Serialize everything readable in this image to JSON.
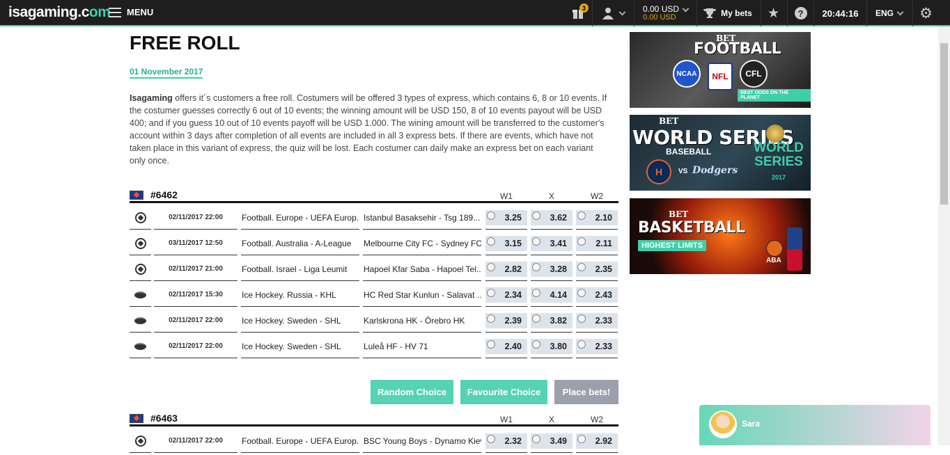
{
  "header": {
    "logo_main": "isagaming.c",
    "logo_accent": "om",
    "menu_label": "MENU",
    "gift_count": "3",
    "balance_main": "0.00 USD",
    "balance_bonus": "0.00 USD",
    "mybets_label": "My bets",
    "time": "20:44:16",
    "language": "ENG",
    "accent_color": "#3fcfa8",
    "icons": [
      "menu-icon",
      "gift-icon",
      "user-icon",
      "trophy-icon",
      "star-icon",
      "help-icon",
      "gear-icon"
    ]
  },
  "page": {
    "title": "FREE ROLL",
    "date": "01 November 2017",
    "desc_brand": "Isagaming",
    "desc_text": " offers it´s customers a free roll. Costumers will be offered 3 types of express, which contains 6, 8 or 10 events. If the costumer guesses correctly 6 out of 10 events; the winning amount will be USD 150, 8 of 10 events payout will be USD 400; and if you guess 10 out of 10 events payoff will be USD 1.000. The wining amount will be transferred to the customer's account within 3 days after completion of all events are included in all 3 express bets. If there are events, which have not taken place in this variant of express, the quiz will be lost. Each costumer can daily make an express bet on each variant only once."
  },
  "columns": {
    "w1": "W1",
    "x": "X",
    "w2": "W2"
  },
  "express1": {
    "id": "#6462",
    "rows": [
      {
        "sport": "football",
        "time": "02/11/2017 22:00",
        "league": "Football. Europe - UEFA Europ...",
        "match": "Istanbul Basaksehir - Tsg 189...",
        "w1": "3.25",
        "x": "3.62",
        "w2": "2.10"
      },
      {
        "sport": "football",
        "time": "03/11/2017 12:50",
        "league": "Football. Australia - A-League",
        "match": "Melbourne City FC - Sydney FC",
        "w1": "3.15",
        "x": "3.41",
        "w2": "2.11"
      },
      {
        "sport": "football",
        "time": "02/11/2017 21:00",
        "league": "Football. Israel - Liga Leumit",
        "match": "Hapoel Kfar Saba - Hapoel Tel...",
        "w1": "2.82",
        "x": "3.28",
        "w2": "2.35"
      },
      {
        "sport": "hockey",
        "time": "02/11/2017 15:30",
        "league": "Ice Hockey. Russia - KHL",
        "match": "HC Red Star Kunlun - Salavat ...",
        "w1": "2.34",
        "x": "4.14",
        "w2": "2.43"
      },
      {
        "sport": "hockey",
        "time": "02/11/2017 22:00",
        "league": "Ice Hockey. Sweden - SHL",
        "match": "Karlskrona HK - Örebro HK",
        "w1": "2.39",
        "x": "3.82",
        "w2": "2.33"
      },
      {
        "sport": "hockey",
        "time": "02/11/2017 22:00",
        "league": "Ice Hockey. Sweden - SHL",
        "match": "Luleå HF - HV 71",
        "w1": "2.40",
        "x": "3.80",
        "w2": "2.33"
      }
    ]
  },
  "buttons": {
    "random": "Random Choice",
    "favourite": "Favourite Choice",
    "place": "Place bets!"
  },
  "express2": {
    "id": "#6463",
    "rows": [
      {
        "sport": "football",
        "time": "02/11/2017 22:00",
        "league": "Football. Europe - UEFA Europ...",
        "match": "BSC Young Boys - Dynamo Kiev",
        "w1": "2.32",
        "x": "3.49",
        "w2": "2.92"
      }
    ]
  },
  "banners": {
    "football": {
      "small": "BET",
      "big": "FOOTBALL",
      "logo1": "NCAA",
      "logo2": "NFL",
      "logo3": "CFL",
      "tag": "BEST ODDS ON THE PLANET"
    },
    "world_series": {
      "small": "BET",
      "big": "WORLD SERIES",
      "sub": "BASEBALL",
      "vs": "VS",
      "team2": "Dodgers",
      "logo": "WORLD SERIES",
      "logo_year": "2017"
    },
    "basketball": {
      "small": "BET",
      "big": "BASKETBALL",
      "tag": "HIGHEST LIMITS",
      "logo1": "ABA"
    }
  },
  "chat": {
    "name": "Sara"
  }
}
